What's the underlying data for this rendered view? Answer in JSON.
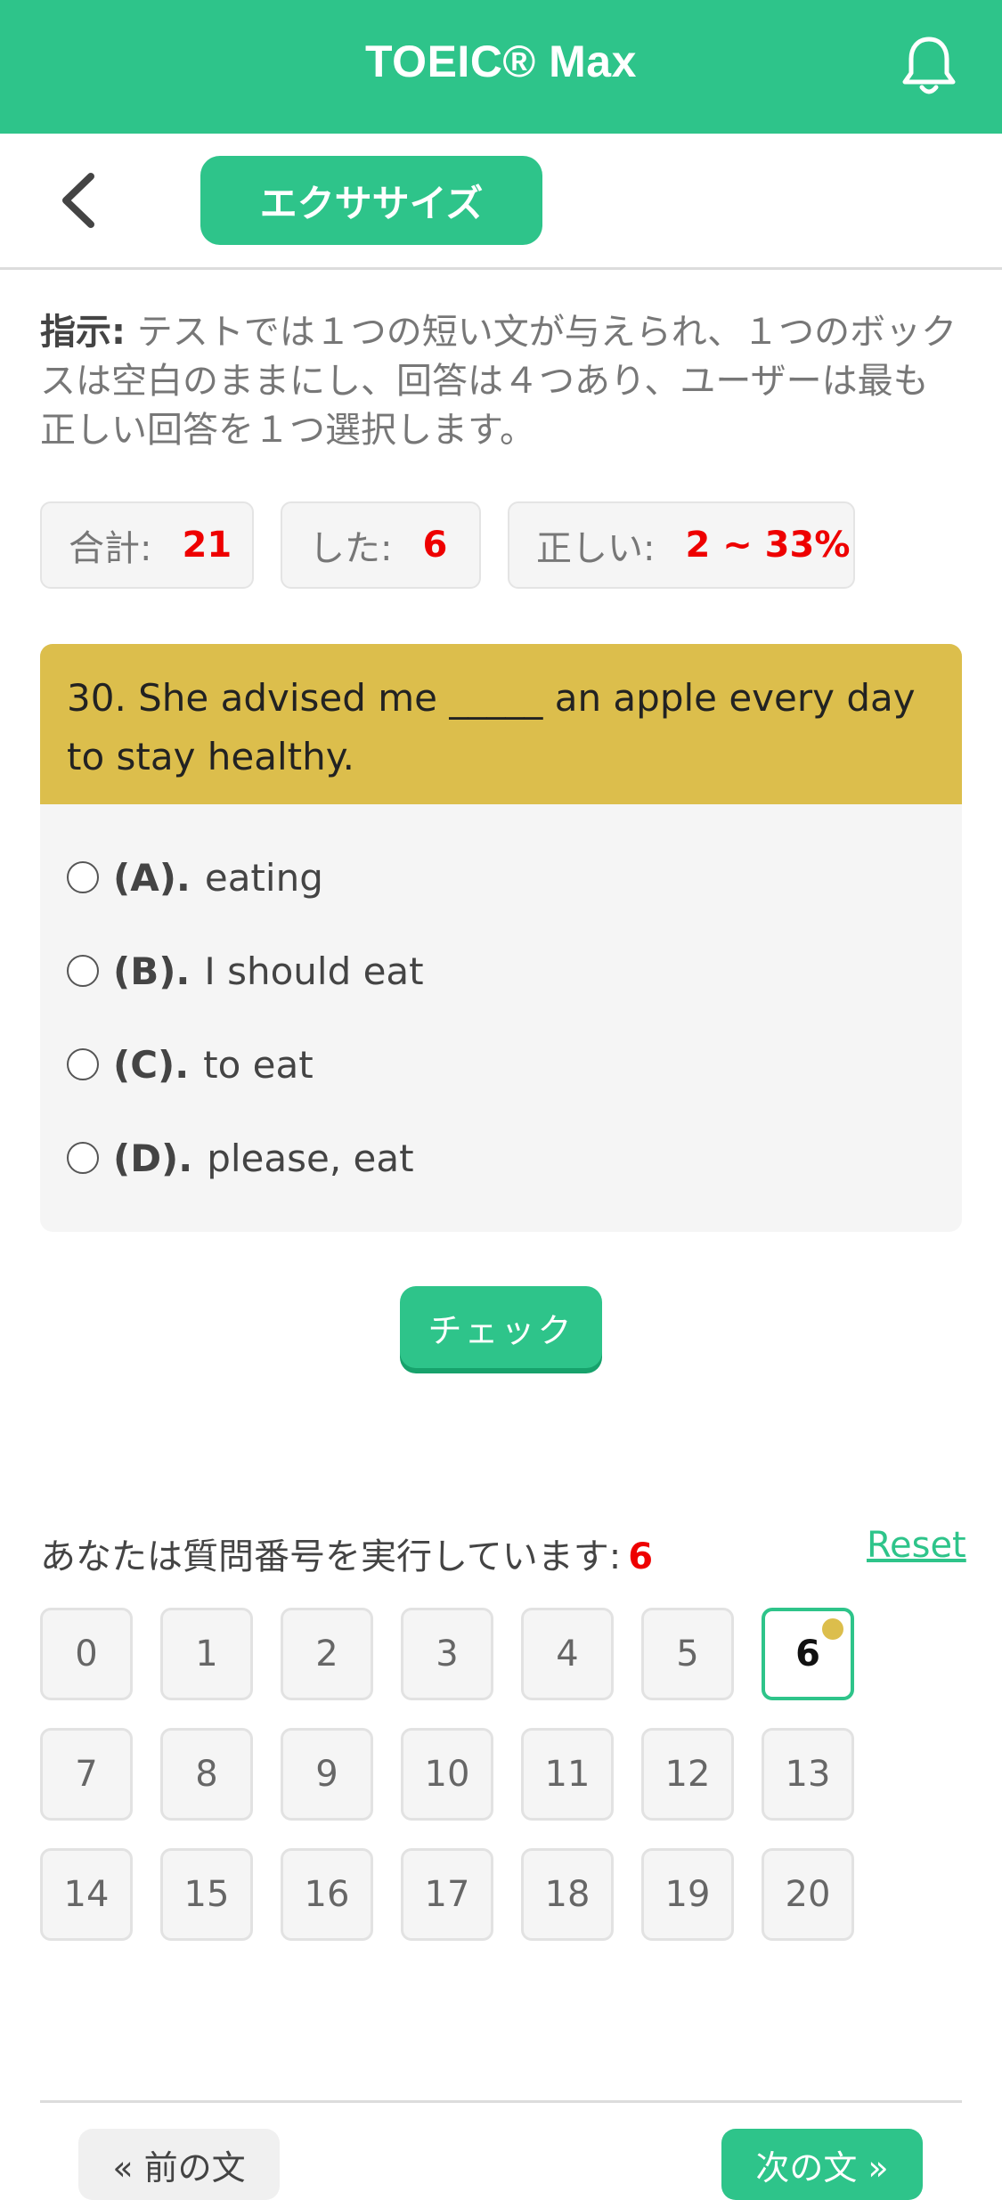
{
  "header": {
    "title": "TOEIC® Max",
    "bell_icon": "bell-icon"
  },
  "subheader": {
    "back_icon": "chevron-left-icon",
    "tab_label": "エクササイズ"
  },
  "instructions": {
    "label": "指示:",
    "text": " テストでは１つの短い文が与えられ、１つのボックスは空白のままにし、回答は４つあり、ユーザーは最も正しい回答を１つ選択します。"
  },
  "stats": {
    "total_label": "合計:",
    "total_value": "21",
    "done_label": "した:",
    "done_value": "6",
    "correct_label": "正しい:",
    "correct_value": "2 ~ 33%"
  },
  "question": {
    "text": "30. She advised me _____ an apple every day to stay healthy.",
    "options": [
      {
        "letter": "(A).",
        "text": "eating"
      },
      {
        "letter": "(B).",
        "text": "I should eat"
      },
      {
        "letter": "(C).",
        "text": "to eat"
      },
      {
        "letter": "(D).",
        "text": "please, eat"
      }
    ]
  },
  "check_button": "チェック",
  "progress": {
    "label": "あなたは質問番号を実行しています:",
    "current": "6",
    "reset": "Reset",
    "numbers": [
      "0",
      "1",
      "2",
      "3",
      "4",
      "5",
      "6",
      "7",
      "8",
      "9",
      "10",
      "11",
      "12",
      "13",
      "14",
      "15",
      "16",
      "17",
      "18",
      "19",
      "20"
    ]
  },
  "footer": {
    "prev": "« 前の文",
    "next": "次の文 »"
  },
  "colors": {
    "brand": "#2ec48a",
    "question_header": "#dcbe4c",
    "highlight": "#e00000"
  }
}
